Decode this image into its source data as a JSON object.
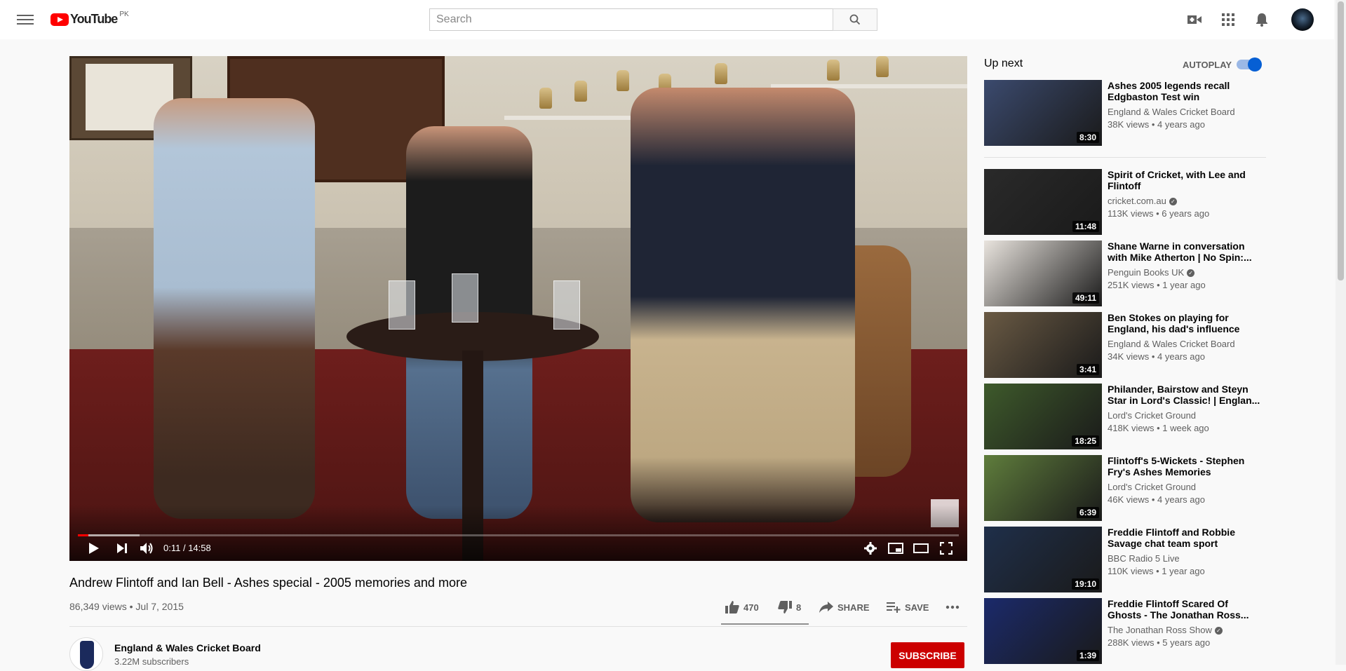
{
  "header": {
    "logo_text": "YouTube",
    "country_code": "PK",
    "search_placeholder": "Search",
    "icons": [
      "menu-icon",
      "search-icon",
      "create-video-icon",
      "apps-icon",
      "notifications-icon",
      "account-avatar"
    ]
  },
  "player": {
    "time_current": "0:11",
    "time_separator": " / ",
    "time_total": "14:58",
    "progress_played_pct": 1.2,
    "progress_loaded_pct": 7
  },
  "video": {
    "title": "Andrew Flintoff and Ian Bell - Ashes special - 2005 memories and more",
    "views": "86,349 views",
    "date": "Jul 7, 2015",
    "likes": "470",
    "dislikes": "8",
    "share_label": "SHARE",
    "save_label": "SAVE"
  },
  "channel": {
    "name": "England & Wales Cricket Board",
    "subscribers": "3.22M subscribers",
    "subscribe_label": "SUBSCRIBE"
  },
  "sidebar": {
    "up_next_label": "Up next",
    "autoplay_label": "AUTOPLAY",
    "autoplay_on": true,
    "items": [
      {
        "title": "Ashes 2005 legends recall Edgbaston Test win",
        "channel": "England & Wales Cricket Board",
        "verified": false,
        "views": "38K views",
        "age": "4 years ago",
        "duration": "8:30",
        "color": "#3b4a6e"
      },
      {
        "title": "Spirit of Cricket, with Lee and Flintoff",
        "channel": "cricket.com.au",
        "verified": true,
        "views": "113K views",
        "age": "6 years ago",
        "duration": "11:48",
        "color": "#2a2a2a"
      },
      {
        "title": "Shane Warne in conversation with Mike Atherton | No Spin:...",
        "channel": "Penguin Books UK",
        "verified": true,
        "views": "251K views",
        "age": "1 year ago",
        "duration": "49:11",
        "color": "#e9e4de"
      },
      {
        "title": "Ben Stokes on playing for England, his dad's influence an...",
        "channel": "England & Wales Cricket Board",
        "verified": false,
        "views": "34K views",
        "age": "4 years ago",
        "duration": "3:41",
        "color": "#6a5a44"
      },
      {
        "title": "Philander, Bairstow and Steyn Star in Lord's Classic! | Englan...",
        "channel": "Lord's Cricket Ground",
        "verified": false,
        "views": "418K views",
        "age": "1 week ago",
        "duration": "18:25",
        "color": "#3e5a2b"
      },
      {
        "title": "Flintoff's 5-Wickets - Stephen Fry's Ashes Memories",
        "channel": "Lord's Cricket Ground",
        "verified": false,
        "views": "46K views",
        "age": "4 years ago",
        "duration": "6:39",
        "color": "#5f7d3c"
      },
      {
        "title": "Freddie Flintoff and Robbie Savage chat team sport",
        "channel": "BBC Radio 5 Live",
        "verified": false,
        "views": "110K views",
        "age": "1 year ago",
        "duration": "19:10",
        "color": "#1f2f4a"
      },
      {
        "title": "Freddie Flintoff Scared Of Ghosts - The Jonathan Ross...",
        "channel": "The Jonathan Ross Show",
        "verified": true,
        "views": "288K views",
        "age": "5 years ago",
        "duration": "1:39",
        "color": "#1b2a6b"
      }
    ]
  }
}
